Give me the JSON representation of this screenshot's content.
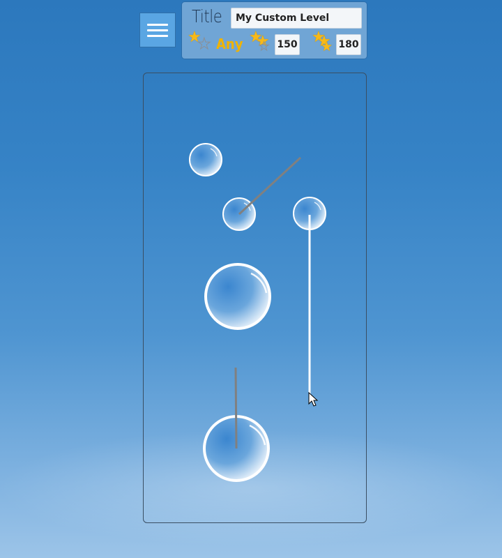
{
  "header": {
    "menu_icon": "hamburger-menu-icon",
    "title_label": "Title",
    "title_value": "My Custom Level",
    "one_star_threshold": "Any",
    "two_star_threshold": "150",
    "three_star_threshold": "180",
    "star_color": "#f7b919",
    "threshold_text_color": "#f0b300"
  },
  "level": {
    "bubbles": [
      {
        "id": "bubble-1",
        "size": "small"
      },
      {
        "id": "bubble-2",
        "size": "small"
      },
      {
        "id": "bubble-3",
        "size": "small"
      },
      {
        "id": "bubble-4",
        "size": "large"
      },
      {
        "id": "bubble-5",
        "size": "large"
      }
    ],
    "aim_lines": 3,
    "active_line_color": "#ffffff",
    "inactive_line_color": "#808080"
  }
}
